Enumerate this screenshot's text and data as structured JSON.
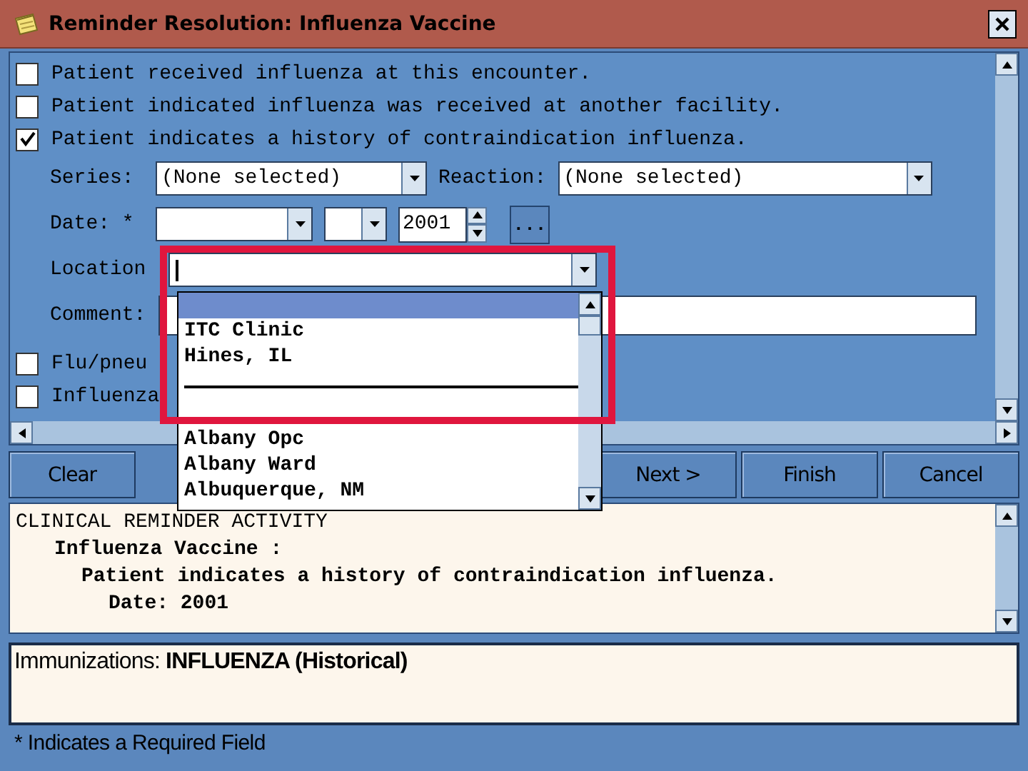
{
  "window": {
    "title": "Reminder Resolution: Influenza Vaccine"
  },
  "options": [
    {
      "label": "Patient received influenza at this encounter.",
      "checked": false
    },
    {
      "label": "Patient indicated influenza was received at another facility.",
      "checked": false
    },
    {
      "label": "Patient indicates a history of contraindication influenza.",
      "checked": true
    }
  ],
  "series": {
    "label": "Series:",
    "value": "(None selected)"
  },
  "reaction": {
    "label": "Reaction:",
    "value": "(None selected)"
  },
  "date": {
    "label": "Date: *",
    "year": "2001",
    "more": "..."
  },
  "location": {
    "label": "Location"
  },
  "comment": {
    "label": "Comment:"
  },
  "more_options": [
    {
      "label": "Flu/pneu",
      "checked": false
    },
    {
      "label": "Influenza",
      "checked": false
    }
  ],
  "dropdown": {
    "items": [
      {
        "kind": "item",
        "selected": true
      },
      {
        "kind": "item",
        "label": "ITC Clinic",
        "selected": false
      },
      {
        "kind": "item",
        "label": "Hines, IL",
        "selected": false
      },
      {
        "kind": "separator"
      },
      {
        "kind": "item",
        "selected": false
      },
      {
        "kind": "item",
        "label": "Albany Opc",
        "selected": false
      },
      {
        "kind": "item",
        "label": "Albany Ward",
        "selected": false
      },
      {
        "kind": "item",
        "label": "Albuquerque, NM",
        "selected": false
      }
    ]
  },
  "buttons": {
    "left": [
      "Clear"
    ],
    "right": [
      "Next >",
      "Finish",
      "Cancel"
    ]
  },
  "activity": {
    "title": "CLINICAL REMINDER ACTIVITY",
    "children": [
      {
        "text": "Influenza Vaccine :",
        "children": [
          {
            "text": "Patient indicates a history of contraindication influenza.",
            "children": [
              {
                "text": "Date: 2001"
              }
            ]
          }
        ]
      }
    ]
  },
  "immunizations": "Immunizations: **INFLUENZA (Historical)**",
  "status_bar": "* Indicates a Required Field"
}
